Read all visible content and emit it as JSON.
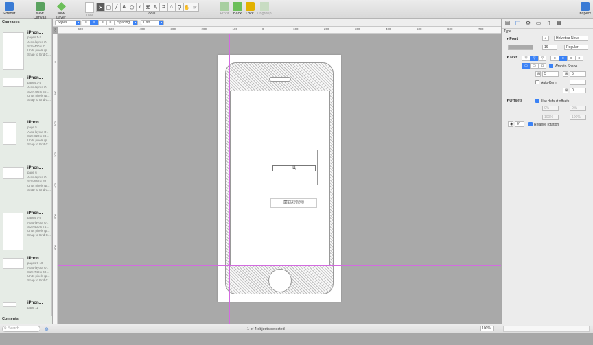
{
  "toolbar": {
    "sidebar": "Sidebar",
    "new_canvas": "New Canvas",
    "new_layer": "New Layer",
    "tool": "Tool",
    "tools": "Tools",
    "front": "Front",
    "back": "Back",
    "lock": "Lock",
    "ungroup": "Ungroup",
    "inspect": "Inspect"
  },
  "stylebar": {
    "styles": "Styles",
    "spacing": "Spacing",
    "lists": "Lists"
  },
  "sidebar": {
    "header": "Canvases",
    "contents": "Contents",
    "search_placeholder": "Search",
    "items": [
      {
        "title": "iPhon…",
        "pages": "pages 1-2",
        "size": "Size 400 x 7…",
        "units": "Units pixels (p…",
        "snap": "Snap to Grid C…",
        "auto": "Auto-layout O…"
      },
      {
        "title": "iPhon…",
        "pages": "pages 3-4",
        "size": "Size 796 x 40…",
        "units": "Units pixels (p…",
        "snap": "Snap to Grid C…",
        "auto": "Auto-layout O…"
      },
      {
        "title": "iPhon…",
        "pages": "page 5",
        "size": "Size 620 x 98…",
        "units": "Units pixels (p…",
        "snap": "Snap to Grid C…",
        "auto": "Auto-layout O…"
      },
      {
        "title": "iPhon…",
        "pages": "page 6",
        "size": "Size 568 x 32…",
        "units": "Units pixels (p…",
        "snap": "Snap to Grid C…",
        "auto": "Auto-layout O…"
      },
      {
        "title": "iPhon…",
        "pages": "pages 7-8",
        "size": "Size 400 x 74…",
        "units": "Units pixels (p…",
        "snap": "Snap to Grid C…",
        "auto": "Auto-layout O…"
      },
      {
        "title": "iPhon…",
        "pages": "pages 9-10",
        "size": "Size 748 x 40…",
        "units": "Units pixels (p…",
        "snap": "Snap to Grid C…",
        "auto": "Auto-layout O…"
      },
      {
        "title": "iPhon…",
        "pages": "page 11",
        "size": "",
        "units": "",
        "snap": "",
        "auto": ""
      }
    ]
  },
  "rulers": {
    "h": [
      "-600",
      "-500",
      "-400",
      "-300",
      "-200",
      "-100",
      "0",
      "100",
      "200",
      "300",
      "400",
      "500",
      "600",
      "700",
      "800"
    ],
    "v": [
      "-100",
      "0",
      "100",
      "200",
      "300",
      "400",
      "500",
      "600"
    ]
  },
  "canvas": {
    "input_text": "Ц",
    "button_text": "蘑菇短视频"
  },
  "status": {
    "selection": "1 of 4 objects selected",
    "zoom": "100%"
  },
  "inspector": {
    "type_label": "Type",
    "font_section": "Font",
    "font_name": "Helvetica Neue",
    "font_size": "16",
    "font_style": "Regular",
    "text_section": "Text",
    "wrap": "Wrap to Shape",
    "v1": "5",
    "v2": "5",
    "auto_kern": "Auto-Kern",
    "kern_val": "0",
    "offsets_section": "Offsets",
    "use_default": "Use default offsets",
    "off1": "0%",
    "off2": "0%",
    "off3": "100%",
    "off4": "100%",
    "rot": "0°",
    "rel_rot": "Relative rotation"
  }
}
